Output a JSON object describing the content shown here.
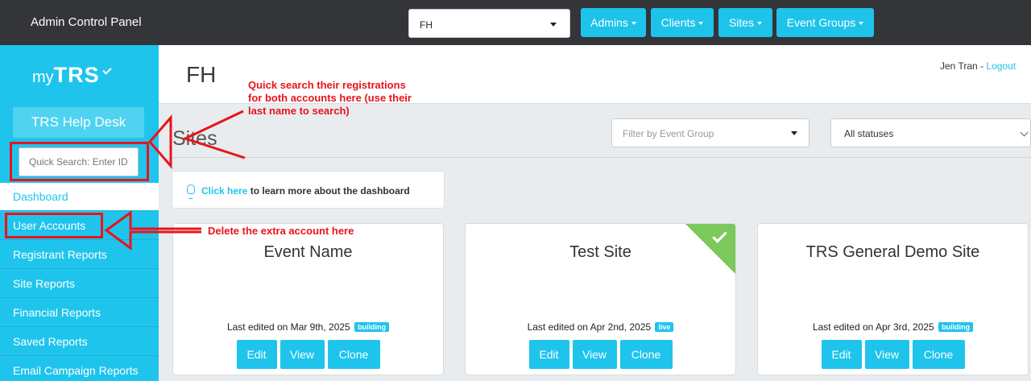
{
  "topbar": {
    "app_title": "Admin Control Panel",
    "site_select_value": "FH",
    "nav": [
      {
        "label": "Admins"
      },
      {
        "label": "Clients"
      },
      {
        "label": "Sites"
      },
      {
        "label": "Event Groups"
      }
    ]
  },
  "sidebar": {
    "logo_my": "my",
    "logo_trs": "TRS",
    "helpdesk_label": "TRS Help Desk",
    "search_placeholder": "Quick Search: Enter ID, Name",
    "items": [
      {
        "label": "Dashboard",
        "active": true
      },
      {
        "label": "User Accounts",
        "active": false
      },
      {
        "label": "Registrant Reports",
        "active": false
      },
      {
        "label": "Site Reports",
        "active": false
      },
      {
        "label": "Financial Reports",
        "active": false
      },
      {
        "label": "Saved Reports",
        "active": false
      },
      {
        "label": "Email Campaign Reports",
        "active": false
      }
    ]
  },
  "header": {
    "page_title": "FH",
    "user_name": "Jen Tran",
    "separator": "-",
    "logout_label": "Logout"
  },
  "sites": {
    "title": "Sites",
    "filter_event_group": "Filter by Event Group",
    "filter_status": "All statuses",
    "tip_link": "Click here",
    "tip_text": "to learn more about the dashboard"
  },
  "cards": [
    {
      "title": "Event Name",
      "edited": "Last edited on Mar 9th, 2025",
      "badge": "building",
      "published": false
    },
    {
      "title": "Test Site",
      "edited": "Last edited on Apr 2nd, 2025",
      "badge": "live",
      "published": true
    },
    {
      "title": "TRS General Demo Site",
      "edited": "Last edited on Apr 3rd, 2025",
      "badge": "building",
      "published": false
    }
  ],
  "card_buttons": {
    "edit": "Edit",
    "view": "View",
    "clone": "Clone"
  },
  "annotations": {
    "search_note": [
      "Quick search their registrations",
      "for both accounts here (use their",
      "last name to search)"
    ],
    "delete_note": "Delete the extra account here",
    "color": "#e8141b"
  },
  "colors": {
    "accent": "#1fc4ec",
    "topbar": "#333538",
    "live_ribbon": "#7cc95b"
  }
}
